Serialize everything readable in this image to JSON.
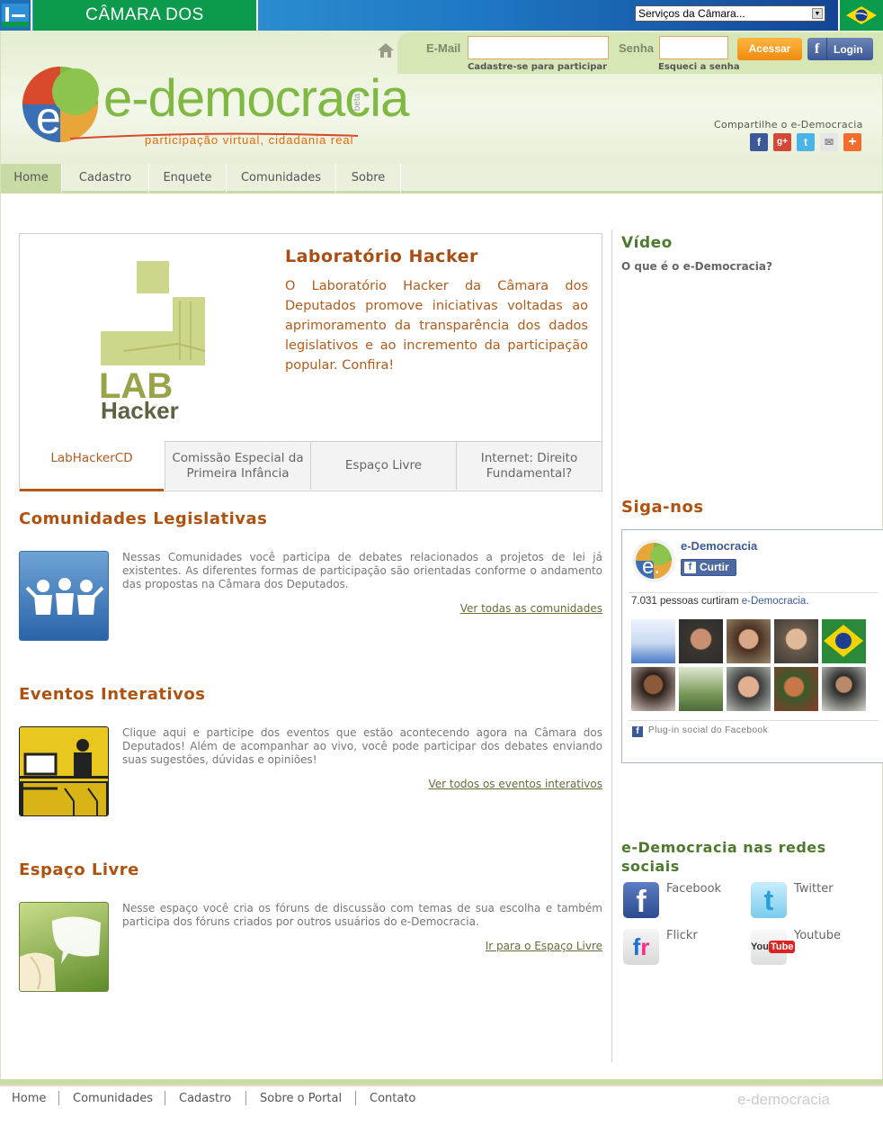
{
  "top_bar": {
    "title": "CÂMARA DOS DEPUTADOS",
    "services_select": "Serviços da Câmara..."
  },
  "login": {
    "email_label": "E-Mail",
    "email_value": "",
    "password_label": "Senha",
    "password_value": "",
    "register_link": "Cadastre-se para participar",
    "forgot_link": "Esqueci a senha",
    "submit_label": "Acessar",
    "fb_login_label": "Login"
  },
  "brand": {
    "logo_text": "e-democracia",
    "logo_beta": "beta",
    "slogan": "participação virtual, cidadania real",
    "share_label": "Compartilhe o e-Democracia"
  },
  "nav": {
    "items": [
      "Home",
      "Cadastro",
      "Enquete",
      "Comunidades",
      "Sobre"
    ]
  },
  "featured": {
    "title": "Laboratório Hacker",
    "text": "O Laboratório Hacker da Câmara dos Deputados promove iniciativas voltadas ao aprimoramento da transparência dos dados legislativos e ao incremento da participação popular. Confira!",
    "logo_line1": "LAB",
    "logo_line2": "Hacker",
    "tabs": [
      {
        "label": "LabHackerCD"
      },
      {
        "label": "Comissão Especial da Primeira Infância"
      },
      {
        "label": "Espaço Livre"
      },
      {
        "label": "Internet: Direito Fundamental?"
      }
    ]
  },
  "sections": [
    {
      "title": "Comunidades Legislativas",
      "text": "Nessas Comunidades você participa de debates relacionados a projetos de lei já existentes. As diferentes formas de participação são orientadas conforme o andamento das propostas na Câmara dos Deputados.",
      "link": "Ver todas as comunidades"
    },
    {
      "title": "Eventos Interativos",
      "text": "Clique aqui e participe dos eventos que estão acontecendo agora na Câmara dos Deputados! Além de acompanhar ao vivo, você pode participar dos debates enviando suas sugestões, dúvidas e opiniões!",
      "link": "Ver todos os eventos interativos"
    },
    {
      "title": "Espaço Livre",
      "text": "Nesse espaço você cria os fóruns de discussão com temas de sua escolha e também participa dos fóruns criados por outros usuários do e-Democracia.",
      "link": "Ir para o Espaço Livre"
    }
  ],
  "sidebar": {
    "video_title": "Vídeo",
    "video_subtitle": "O que é o e-Democracia?",
    "follow_title": "Siga-nos",
    "fb_page_name": "e-Democracia",
    "fb_like_button": "Curtir",
    "fb_likes_text": "7.031 pessoas curtiram",
    "fb_likes_page": "e-Democracia.",
    "fb_plugin_label": "Plug-in social do Facebook",
    "networks_title": "e-Democracia nas redes sociais",
    "networks": [
      {
        "label": "Facebook",
        "icon": "facebook-icon"
      },
      {
        "label": "Twitter",
        "icon": "twitter-icon"
      },
      {
        "label": "Flickr",
        "icon": "flickr-icon"
      },
      {
        "label": "Youtube",
        "icon": "youtube-icon"
      }
    ]
  },
  "footer": {
    "links": [
      "Home",
      "Comunidades",
      "Cadastro",
      "Sobre o Portal",
      "Contato"
    ],
    "logo": "e-democracia"
  },
  "colors": {
    "accent_orange": "#b0520f",
    "accent_green": "#7fb842",
    "nav_bg": "#e9f0dc",
    "facebook_blue": "#3b5998"
  }
}
